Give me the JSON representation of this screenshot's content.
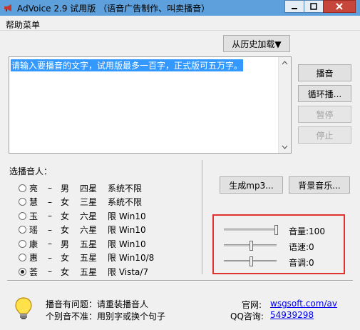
{
  "window": {
    "title": "AdVoice 2.9 试用版 （语音广告制作、叫卖播音）",
    "app_icon": "megaphone-icon",
    "controls": [
      "minimize-icon",
      "maximize-icon",
      "close-icon"
    ]
  },
  "menu": {
    "help": "帮助菜单"
  },
  "history_button": "从历史加载▼",
  "text_input": {
    "value": "请输入要播音的文字，试用版最多一百字，正式版可五万字。"
  },
  "actions": {
    "play": "播音",
    "loop_play": "循环播...",
    "pause": "暂停",
    "stop": "停止"
  },
  "voice_section": {
    "label": "选播音人：",
    "selected_index": 6,
    "voices": [
      {
        "name": "亮",
        "gender": "男",
        "stars": "四星",
        "limit": "系统不限"
      },
      {
        "name": "慧",
        "gender": "女",
        "stars": "三星",
        "limit": "系统不限"
      },
      {
        "name": "玉",
        "gender": "女",
        "stars": "六星",
        "limit": "限 Win10"
      },
      {
        "name": "瑶",
        "gender": "女",
        "stars": "六星",
        "limit": "限 Win10"
      },
      {
        "name": "康",
        "gender": "男",
        "stars": "五星",
        "limit": "限 Win10"
      },
      {
        "name": "惠",
        "gender": "女",
        "stars": "五星",
        "limit": "限 Win10/8"
      },
      {
        "name": "荟",
        "gender": "女",
        "stars": "五星",
        "limit": "限 Vista/7"
      }
    ]
  },
  "tools": {
    "generate_mp3": "生成mp3...",
    "bg_music": "背景音乐..."
  },
  "sliders": [
    {
      "label": "音量:100",
      "value": 100,
      "min": 0,
      "max": 100
    },
    {
      "label": "语速:0",
      "value": 0,
      "min": -10,
      "max": 10
    },
    {
      "label": "音调:0",
      "value": 0,
      "min": -10,
      "max": 10
    }
  ],
  "footer": {
    "tip_icon": "lightbulb-icon",
    "tip_line1": "播音有问题：请重装播音人",
    "tip_line2": "个别音不准：用别字或换个句子",
    "site_label": "官网:",
    "site_value": "wsgsoft.com/av",
    "qq_label": "QQ咨询:",
    "qq_value": "54939298"
  },
  "colors": {
    "titlebar": "#5ea0dc",
    "selection": "#3399ff",
    "highlight_box": "#e03030",
    "link": "#0000ee"
  }
}
